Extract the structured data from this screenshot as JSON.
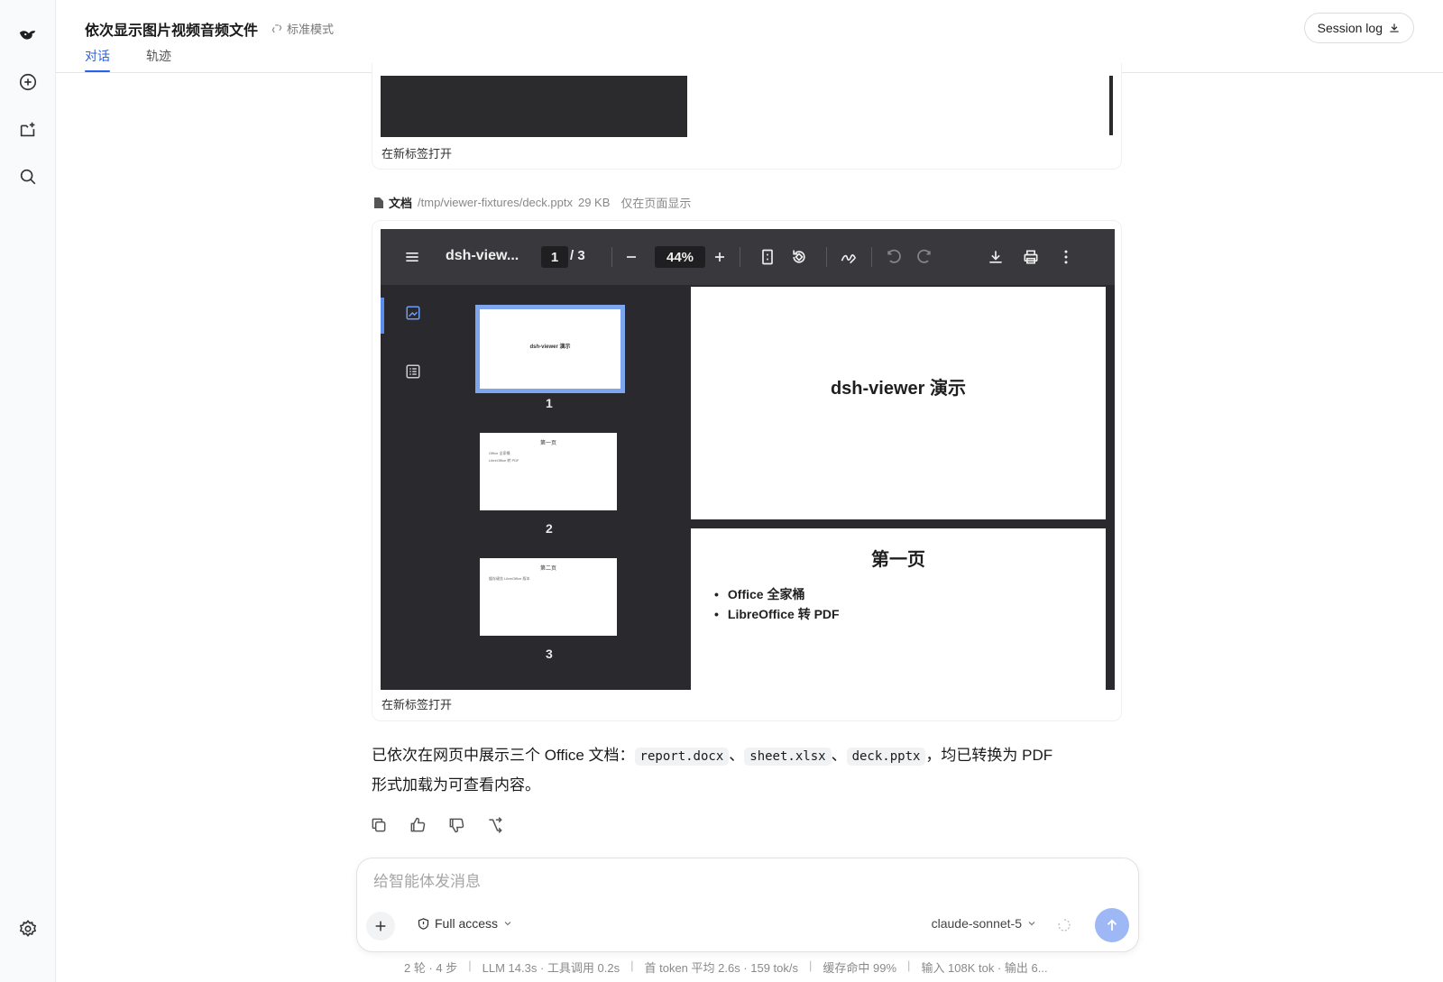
{
  "header": {
    "title": "依次显示图片视频音频文件",
    "mode": "标准模式",
    "tabs": [
      {
        "label": "对话",
        "active": true
      },
      {
        "label": "轨迹",
        "active": false
      }
    ],
    "session_log": "Session log"
  },
  "sidebar": {
    "items": [
      {
        "icon": "logo-whale-icon"
      },
      {
        "icon": "new-chat-icon"
      },
      {
        "icon": "new-project-icon"
      },
      {
        "icon": "search-icon"
      }
    ],
    "footer_icon": "settings-icon"
  },
  "previous_card": {
    "open_link": "在新标签打开"
  },
  "file": {
    "kind": "文档",
    "path": "/tmp/viewer-fixtures/deck.pptx",
    "size": "29 KB",
    "note": "仅在页面显示"
  },
  "viewer": {
    "doc_title": "dsh-view...",
    "page_current": "1",
    "page_total": "/ 3",
    "zoom": "44%",
    "thumbnails": [
      {
        "num": "1",
        "title": "dsh-viewer 演示",
        "bullets": []
      },
      {
        "num": "2",
        "title": "第一页",
        "bullets": [
          "Office 全家桶",
          "LibreOffice 转 PDF"
        ]
      },
      {
        "num": "3",
        "title": "第二页",
        "bullets": [
          "缓存键含 LibreOffice 版本"
        ]
      }
    ],
    "slide1_title": "dsh-viewer  演示",
    "slide2_title": "第一页",
    "slide2_bullets": [
      "Office  全家桶",
      "LibreOffice  转  PDF"
    ],
    "open_link": "在新标签打开"
  },
  "message": {
    "pre": "已依次在网页中展示三个 Office 文档：",
    "files": [
      "report.docx",
      "sheet.xlsx",
      "deck.pptx"
    ],
    "sep": "、",
    "post_a": "，均已转换为 PDF",
    "post_b": "形式加载为可查看内容。"
  },
  "composer": {
    "placeholder": "给智能体发消息",
    "access": "Full access",
    "model": "claude-sonnet-5"
  },
  "status": {
    "turns": "2 轮 · 4 步",
    "llm": "LLM 14.3s · 工具调用 0.2s",
    "token": "首 token 平均 2.6s · 159 tok/s",
    "cache": "缓存命中 99%",
    "io": "输入 108K tok · 输出 6..."
  },
  "colors": {
    "accent": "#2563eb",
    "viewer_bg": "#2a2a2e",
    "toolbar_bg": "#38383d",
    "send_button": "#9db8f4"
  }
}
